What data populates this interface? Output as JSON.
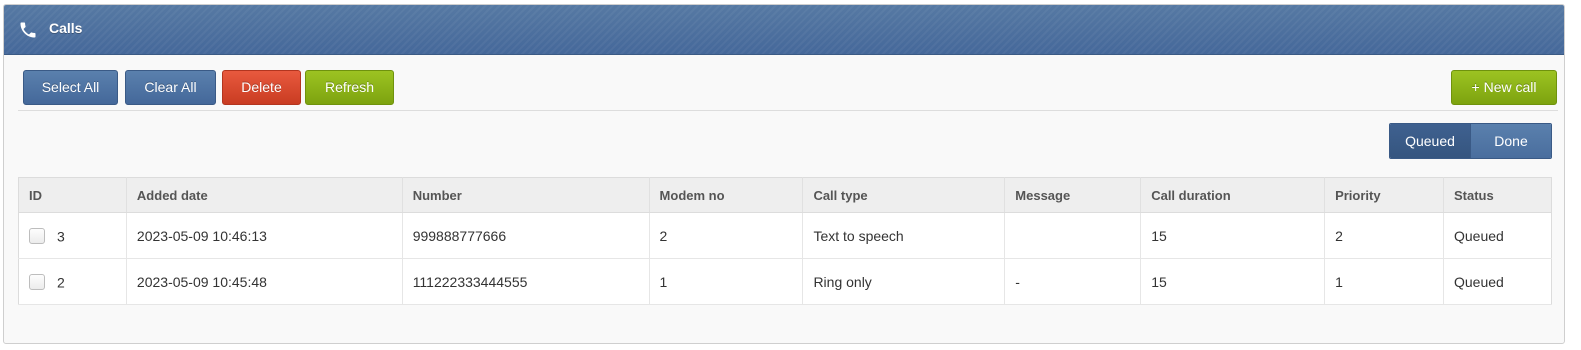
{
  "header": {
    "title": "Calls",
    "icon": "phone-icon"
  },
  "toolbar": {
    "select_all": "Select All",
    "clear_all": "Clear All",
    "delete": "Delete",
    "refresh": "Refresh",
    "new_call": "+ New call"
  },
  "filter": {
    "queued": "Queued",
    "done": "Done",
    "active": "Queued"
  },
  "table": {
    "columns": [
      "ID",
      "Added date",
      "Number",
      "Modem no",
      "Call type",
      "Message",
      "Call duration",
      "Priority",
      "Status"
    ],
    "rows": [
      {
        "id": "3",
        "added_date": "2023-05-09 10:46:13",
        "number": "999888777666",
        "modem_no": "2",
        "call_type": "Text to speech",
        "message": "",
        "call_duration": "15",
        "priority": "2",
        "status": "Queued"
      },
      {
        "id": "2",
        "added_date": "2023-05-09 10:45:48",
        "number": "111222333444555",
        "modem_no": "1",
        "call_type": "Ring only",
        "message": "-",
        "call_duration": "15",
        "priority": "1",
        "status": "Queued"
      }
    ]
  },
  "colors": {
    "header": "#4a6d9c",
    "danger": "#d9462b",
    "success": "#8db318"
  }
}
